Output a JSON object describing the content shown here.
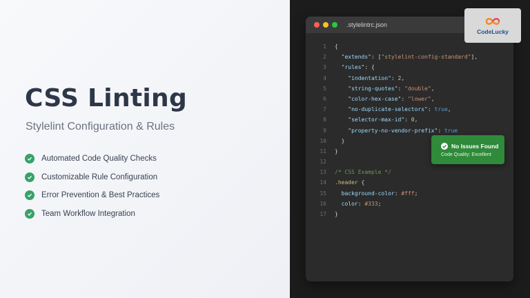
{
  "slide": {
    "title": "CSS Linting",
    "subtitle": "Stylelint Configuration & Rules",
    "features": [
      "Automated Code Quality Checks",
      "Customizable Rule Configuration",
      "Error Prevention & Best Practices",
      "Team Workflow Integration"
    ]
  },
  "editor": {
    "filename": ".stylelintrc.json",
    "lines": [
      {
        "n": "1",
        "segs": [
          {
            "t": "{",
            "c": "#d4d4d4"
          }
        ]
      },
      {
        "n": "2",
        "segs": [
          {
            "t": "  \"extends\"",
            "c": "#9cdcfe"
          },
          {
            "t": ": [",
            "c": "#d4d4d4"
          },
          {
            "t": "\"stylelint-config-standard\"",
            "c": "#ce9178"
          },
          {
            "t": "],",
            "c": "#d4d4d4"
          }
        ]
      },
      {
        "n": "3",
        "segs": [
          {
            "t": "  \"rules\"",
            "c": "#9cdcfe"
          },
          {
            "t": ": {",
            "c": "#d4d4d4"
          }
        ]
      },
      {
        "n": "4",
        "segs": [
          {
            "t": "    \"indentation\"",
            "c": "#9cdcfe"
          },
          {
            "t": ": ",
            "c": "#d4d4d4"
          },
          {
            "t": "2",
            "c": "#b5cea8"
          },
          {
            "t": ",",
            "c": "#d4d4d4"
          }
        ]
      },
      {
        "n": "5",
        "segs": [
          {
            "t": "    \"string-quotes\"",
            "c": "#9cdcfe"
          },
          {
            "t": ": ",
            "c": "#d4d4d4"
          },
          {
            "t": "\"double\"",
            "c": "#ce9178"
          },
          {
            "t": ",",
            "c": "#d4d4d4"
          }
        ]
      },
      {
        "n": "6",
        "segs": [
          {
            "t": "    \"color-hex-case\"",
            "c": "#9cdcfe"
          },
          {
            "t": ": ",
            "c": "#d4d4d4"
          },
          {
            "t": "\"lower\"",
            "c": "#ce9178"
          },
          {
            "t": ",",
            "c": "#d4d4d4"
          }
        ]
      },
      {
        "n": "7",
        "segs": [
          {
            "t": "    \"no-duplicate-selectors\"",
            "c": "#9cdcfe"
          },
          {
            "t": ": ",
            "c": "#d4d4d4"
          },
          {
            "t": "true",
            "c": "#569cd6"
          },
          {
            "t": ",",
            "c": "#d4d4d4"
          }
        ]
      },
      {
        "n": "8",
        "segs": [
          {
            "t": "    \"selector-max-id\"",
            "c": "#9cdcfe"
          },
          {
            "t": ": ",
            "c": "#d4d4d4"
          },
          {
            "t": "0",
            "c": "#b5cea8"
          },
          {
            "t": ",",
            "c": "#d4d4d4"
          }
        ]
      },
      {
        "n": "9",
        "segs": [
          {
            "t": "    \"property-no-vendor-prefix\"",
            "c": "#9cdcfe"
          },
          {
            "t": ": ",
            "c": "#d4d4d4"
          },
          {
            "t": "true",
            "c": "#569cd6"
          }
        ]
      },
      {
        "n": "10",
        "segs": [
          {
            "t": "  }",
            "c": "#d4d4d4"
          }
        ]
      },
      {
        "n": "11",
        "segs": [
          {
            "t": "}",
            "c": "#d4d4d4"
          }
        ]
      },
      {
        "n": "12",
        "segs": [
          {
            "t": "",
            "c": "#d4d4d4"
          }
        ]
      },
      {
        "n": "13",
        "segs": [
          {
            "t": "/* CSS Example */",
            "c": "#6a9955"
          }
        ]
      },
      {
        "n": "14",
        "segs": [
          {
            "t": ".header",
            "c": "#d7ba7d"
          },
          {
            "t": " {",
            "c": "#d4d4d4"
          }
        ]
      },
      {
        "n": "15",
        "segs": [
          {
            "t": "  background-color",
            "c": "#9cdcfe"
          },
          {
            "t": ": ",
            "c": "#d4d4d4"
          },
          {
            "t": "#fff",
            "c": "#ce9178"
          },
          {
            "t": ";",
            "c": "#d4d4d4"
          }
        ]
      },
      {
        "n": "16",
        "segs": [
          {
            "t": "  color",
            "c": "#9cdcfe"
          },
          {
            "t": ": ",
            "c": "#d4d4d4"
          },
          {
            "t": "#333",
            "c": "#ce9178"
          },
          {
            "t": ";",
            "c": "#d4d4d4"
          }
        ]
      },
      {
        "n": "17",
        "segs": [
          {
            "t": "}",
            "c": "#d4d4d4"
          }
        ]
      }
    ]
  },
  "badge": {
    "title": "No Issues Found",
    "subtitle": "Code Quality: Excellent",
    "icon": "check-circle-icon"
  },
  "logo": {
    "text": "CodeLucky",
    "icon": "infinity-logo-icon"
  },
  "colors": {
    "accent_green": "#38a169",
    "badge_green": "#2f8a3a",
    "title": "#2d3748"
  }
}
